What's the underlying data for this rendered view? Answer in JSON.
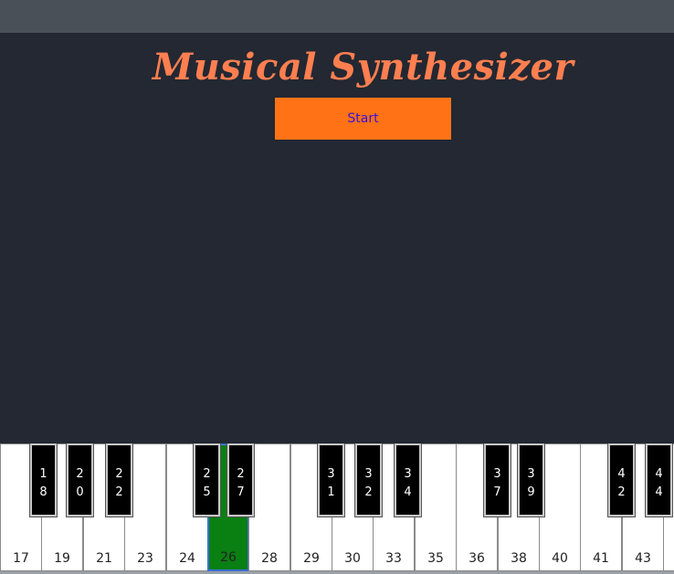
{
  "title": "Musical Synthesizer",
  "start_label": "Start",
  "active_key": "26",
  "white_keys": [
    "17",
    "19",
    "21",
    "23",
    "24",
    "26",
    "28",
    "29",
    "30",
    "33",
    "35",
    "36",
    "38",
    "40",
    "41",
    "43",
    ""
  ],
  "black_keys": [
    "18",
    "20",
    "22",
    "25",
    "27",
    "31",
    "32",
    "34",
    "37",
    "39",
    "42",
    "44"
  ],
  "colors": {
    "background": "#232832",
    "title": "#ff7f50",
    "start_button": "#ff7316",
    "active_key": "#0a7f12"
  }
}
